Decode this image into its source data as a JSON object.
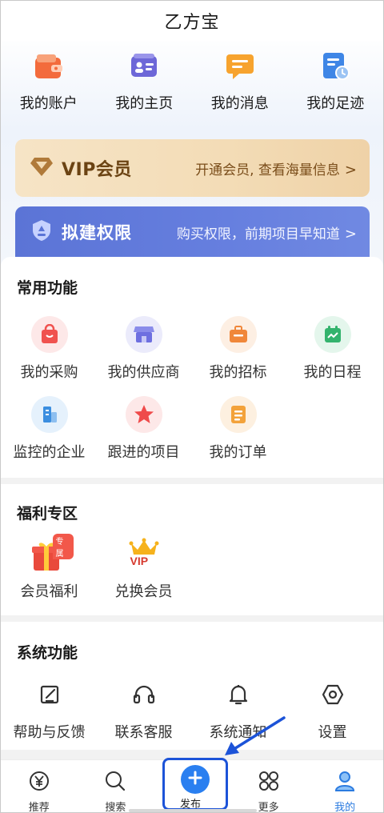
{
  "app": {
    "title": "乙方宝"
  },
  "quick": [
    {
      "label": "我的账户",
      "icon": "wallet-icon"
    },
    {
      "label": "我的主页",
      "icon": "id-card-icon"
    },
    {
      "label": "我的消息",
      "icon": "message-icon"
    },
    {
      "label": "我的足迹",
      "icon": "history-doc-icon"
    }
  ],
  "vip": {
    "title": "VIP会员",
    "subtitle": "开通会员, 查看海量信息",
    "chevron": ">"
  },
  "perm": {
    "title": "拟建权限",
    "subtitle": "购买权限，前期项目早知道",
    "chevron": ">"
  },
  "common": {
    "title": "常用功能",
    "items": [
      {
        "label": "我的采购",
        "icon": "shopping-bag-icon",
        "bg": "#fde8e8",
        "fg": "#f0524f"
      },
      {
        "label": "我的供应商",
        "icon": "store-icon",
        "bg": "#ebebfb",
        "fg": "#6d6fe0"
      },
      {
        "label": "我的招标",
        "icon": "briefcase-icon",
        "bg": "#fdefe3",
        "fg": "#f0873a"
      },
      {
        "label": "我的日程",
        "icon": "calendar-icon",
        "bg": "#e4f6ec",
        "fg": "#33b36d"
      },
      {
        "label": "监控的企业",
        "icon": "building-icon",
        "bg": "#e5f1fc",
        "fg": "#3b8ee0"
      },
      {
        "label": "跟进的项目",
        "icon": "star-icon",
        "bg": "#fde8e8",
        "fg": "#ef4a4a"
      },
      {
        "label": "我的订单",
        "icon": "order-list-icon",
        "bg": "#fdf0e0",
        "fg": "#f3a23a"
      }
    ]
  },
  "welfare": {
    "title": "福利专区",
    "items": [
      {
        "label": "会员福利",
        "icon": "gift-icon",
        "badge": "专属"
      },
      {
        "label": "兑换会员",
        "icon": "vip-crown-icon",
        "badge_text": "VIP"
      }
    ]
  },
  "system": {
    "title": "系统功能",
    "items": [
      {
        "label": "帮助与反馈",
        "icon": "feedback-edit-icon"
      },
      {
        "label": "联系客服",
        "icon": "headset-icon"
      },
      {
        "label": "系统通知",
        "icon": "bell-icon"
      },
      {
        "label": "设置",
        "icon": "settings-icon"
      }
    ]
  },
  "nav": {
    "items": [
      {
        "label": "推荐",
        "icon": "yen-icon"
      },
      {
        "label": "搜索",
        "icon": "search-icon"
      },
      {
        "label": "发布",
        "icon": "plus-icon"
      },
      {
        "label": "更多",
        "icon": "grid-icon"
      },
      {
        "label": "我的",
        "icon": "user-icon",
        "active": true
      }
    ]
  },
  "colors": {
    "accent": "#2b7be0",
    "annotation": "#1c53d8",
    "vip_text": "#6b4313",
    "perm_bg": "#5b74d6"
  }
}
